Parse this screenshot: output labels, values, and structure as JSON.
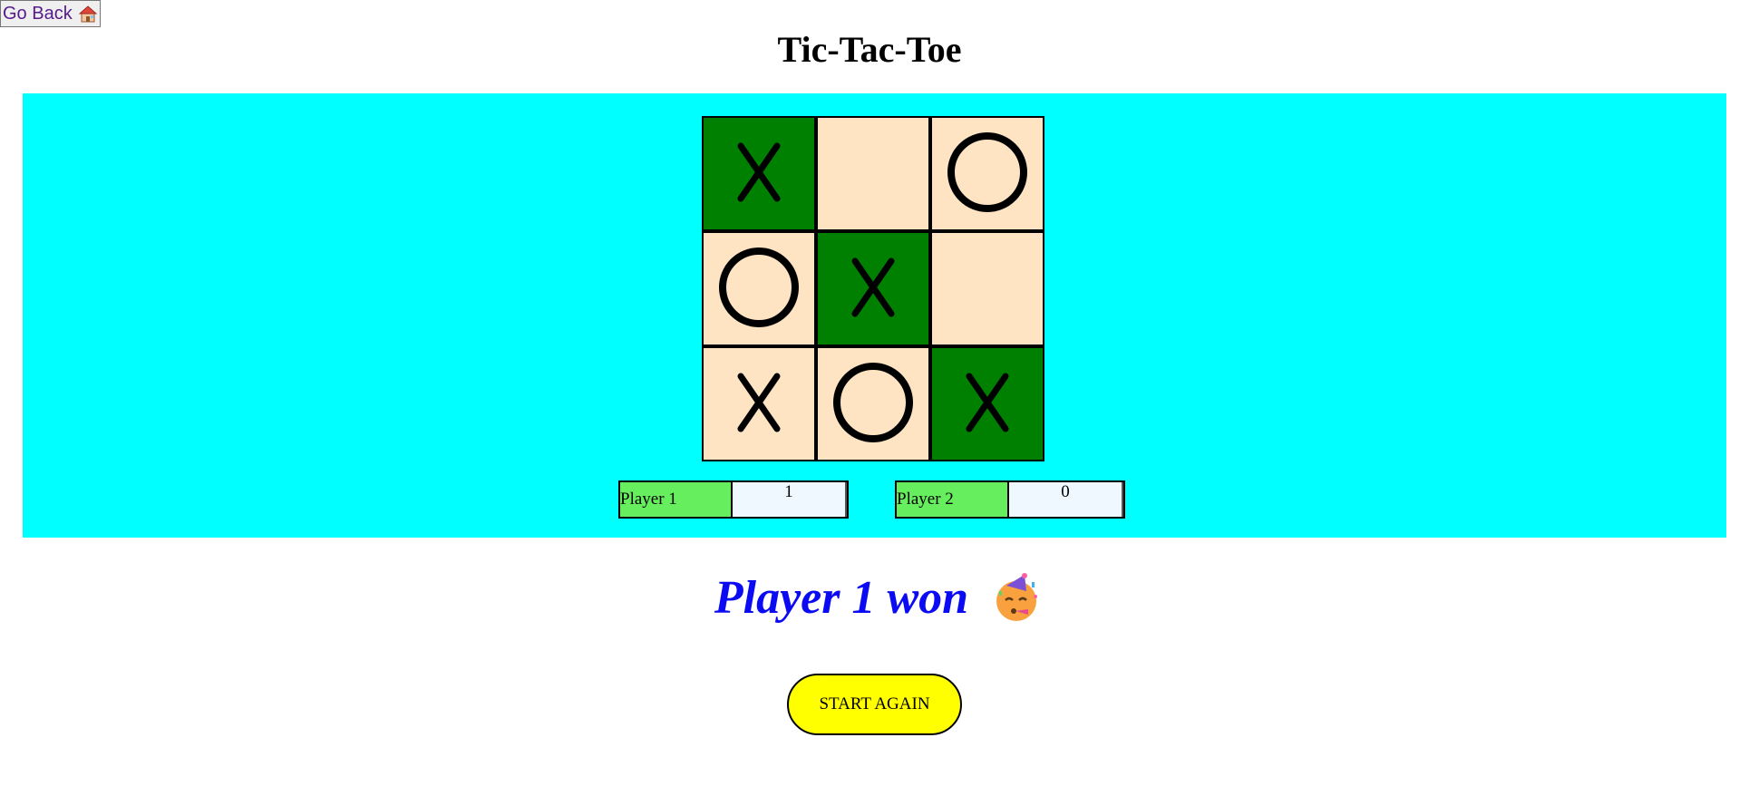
{
  "nav": {
    "back_label": "Go Back",
    "back_icon": "house-icon"
  },
  "title": "Tic-Tac-Toe",
  "colors": {
    "panel": "#00ffff",
    "cell": "#ffe4c4",
    "win_cell": "#008000",
    "score_label": "#66ee5e",
    "result_text": "#0b0bf3",
    "start_button": "#ffff00"
  },
  "board": {
    "cells": [
      {
        "mark": "X",
        "winning": true
      },
      {
        "mark": "",
        "winning": false
      },
      {
        "mark": "O",
        "winning": false
      },
      {
        "mark": "O",
        "winning": false
      },
      {
        "mark": "X",
        "winning": true
      },
      {
        "mark": "",
        "winning": false
      },
      {
        "mark": "X",
        "winning": false
      },
      {
        "mark": "O",
        "winning": false
      },
      {
        "mark": "X",
        "winning": true
      }
    ]
  },
  "scores": [
    {
      "player": "Player 1",
      "value": "1"
    },
    {
      "player": "Player 2",
      "value": "0"
    }
  ],
  "result": {
    "text": "Player 1 won",
    "icon": "party-face-icon"
  },
  "start_again_label": "START AGAIN"
}
